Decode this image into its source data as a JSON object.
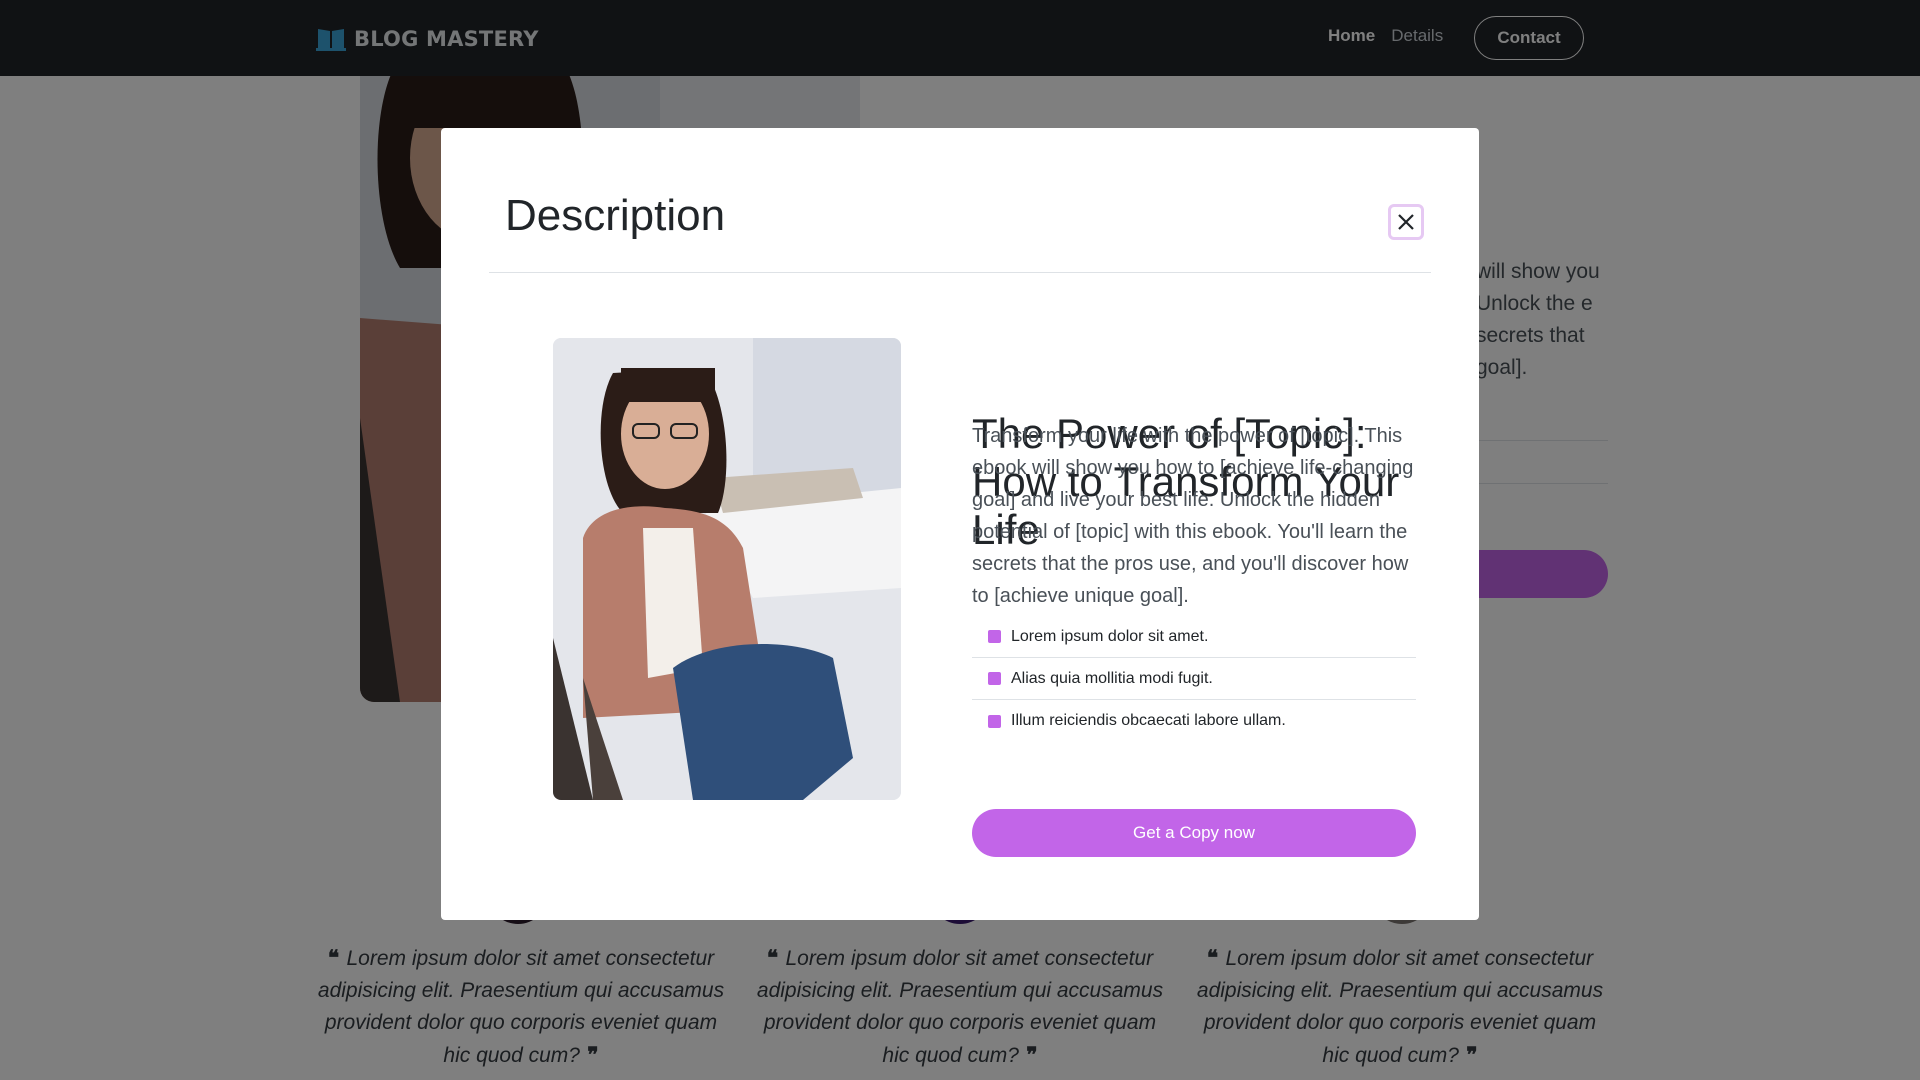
{
  "nav": {
    "brand": "BLOG MASTERY",
    "links": [
      "Home",
      "Details"
    ],
    "contact": "Contact"
  },
  "hero": {
    "title_fragment": ")",
    "text_fragment": "will show you Unlock the e secrets that goal]."
  },
  "testimonials": [
    {
      "quote": "Lorem ipsum dolor sit amet consectetur adipisicing elit. Praesentium qui accusamus provident dolor quo corporis eveniet quam hic quod cum?"
    },
    {
      "quote": "Lorem ipsum dolor sit amet consectetur adipisicing elit. Praesentium qui accusamus provident dolor quo corporis eveniet quam hic quod cum?"
    },
    {
      "quote": "Lorem ipsum dolor sit amet consectetur adipisicing elit. Praesentium qui accusamus provident dolor quo corporis eveniet quam hic quod cum?"
    }
  ],
  "modal": {
    "title": "Description",
    "close_icon": "close-icon",
    "book_title": "The Power of [Topic]: How to Transform Your Life",
    "description": "Transform your life with the power of [topic]. This ebook will show you how to [achieve life-changing goal] and live your best life. Unlock the hidden potential of [topic] with this ebook. You'll learn the secrets that the pros use, and you'll discover how to [achieve unique goal].",
    "features": [
      "Lorem ipsum dolor sit amet.",
      "Alias quia mollitia modi fugit.",
      "Illum reiciendis obcaecati labore ullam."
    ],
    "cta": "Get a Copy now"
  },
  "colors": {
    "accent": "#c265e8",
    "navbar": "#212529",
    "backdrop": "rgba(0,0,0,0.5)"
  }
}
